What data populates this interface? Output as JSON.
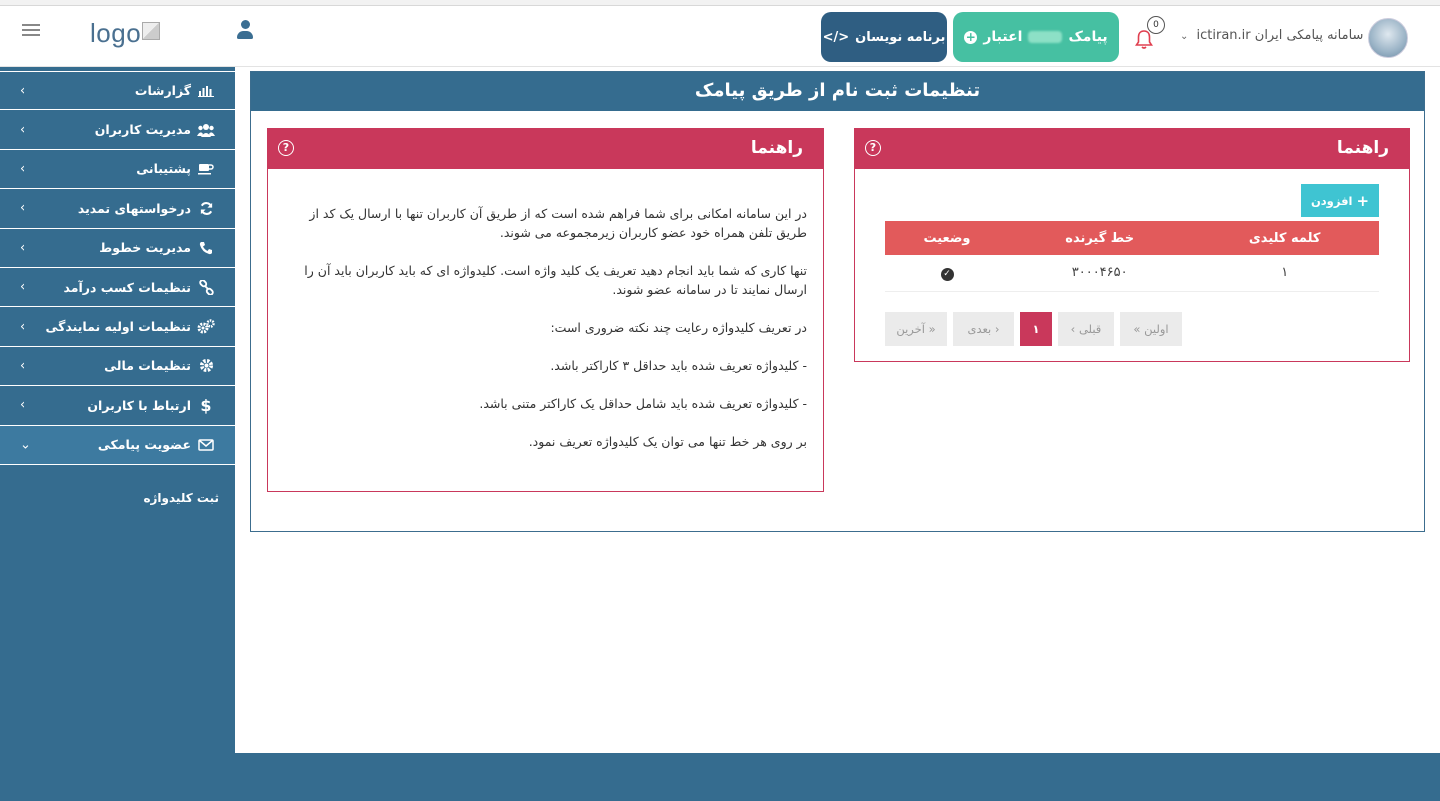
{
  "header": {
    "logo": "logo",
    "dev_button": "برنامه نویسان",
    "credit_label": "اعتبار",
    "credit_unit": "پیامک",
    "notification_count": "0",
    "site_name": "سامانه پیامکی ایران ictiran.ir"
  },
  "sidebar": {
    "items": [
      {
        "label": "گزارشات",
        "icon": "bar-chart-icon"
      },
      {
        "label": "مدیریت کاربران",
        "icon": "users-icon"
      },
      {
        "label": "پشتیبانی",
        "icon": "coffee-icon"
      },
      {
        "label": "درخواستهای تمدید",
        "icon": "refresh-icon"
      },
      {
        "label": "مدیریت خطوط",
        "icon": "phone-icon"
      },
      {
        "label": "تنظیمات کسب درآمد",
        "icon": "link-icon"
      },
      {
        "label": "تنظیمات اولیه نمایندگی",
        "icon": "gears-icon"
      },
      {
        "label": "تنظیمات مالی",
        "icon": "gear-icon"
      },
      {
        "label": "ارتباط با کاربران",
        "icon": "dollar-icon"
      },
      {
        "label": "عضویت پیامکی",
        "icon": "envelope-icon"
      }
    ],
    "sub_item": "ثبت کلیدواژه"
  },
  "main": {
    "title": "تنظیمات ثبت نام از طریق پیامک",
    "right_card": {
      "title": "راهنما",
      "add_button": "افزودن",
      "columns": [
        "کلمه کلیدی",
        "خط گیرنده",
        "وضعیت"
      ],
      "rows": [
        {
          "keyword": "۱",
          "line": "۳۰۰۰۴۶۵۰"
        }
      ],
      "pager": {
        "first": "« اولین",
        "prev": "‹ قبلی",
        "page": "۱",
        "next": "بعدی ›",
        "last": "آخرین »"
      }
    },
    "left_card": {
      "title": "راهنما",
      "paragraphs": [
        "در این سامانه امکانی برای شما فراهم شده است که از طریق آن کاربران تنها با ارسال یک کد از طریق تلفن همراه خود عضو کاربران زیرمجموعه می شوند.",
        "تنها کاری که شما باید انجام دهید تعریف یک کلید واژه است. کلیدواژه ای که باید کاربران باید آن را ارسال نمایند تا در سامانه عضو شوند.",
        "در تعریف کلیدواژه رعایت چند نکته ضروری است:",
        "- کلیدواژه تعریف شده باید حداقل ۳ کاراکتر باشد.",
        "- کلیدواژه تعریف شده باید شامل حداقل یک کاراکتر متنی باشد.",
        "بر روی هر خط تنها می توان یک کلیدواژه تعریف نمود."
      ]
    }
  },
  "colors": {
    "sidebar": "#356c8f",
    "card_header": "#c9385b",
    "table_header": "#e25a5b",
    "credit_button": "#46c0a2",
    "add_button": "#3fc4d2"
  }
}
